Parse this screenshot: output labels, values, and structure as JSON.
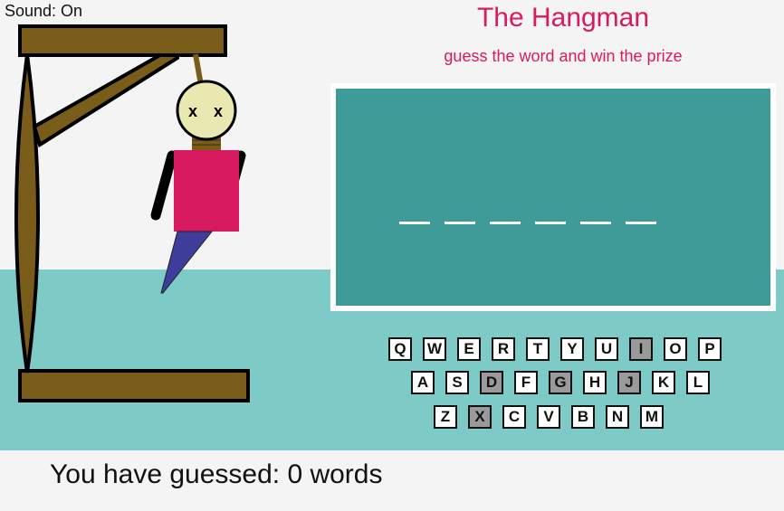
{
  "sound": {
    "label": "Sound: On"
  },
  "header": {
    "title": "The Hangman",
    "subtitle": "guess the word and win the prize"
  },
  "word": {
    "slot_count": 6
  },
  "keyboard": {
    "rows": [
      [
        "Q",
        "W",
        "E",
        "R",
        "T",
        "Y",
        "U",
        "I",
        "O",
        "P"
      ],
      [
        "A",
        "S",
        "D",
        "F",
        "G",
        "H",
        "J",
        "K",
        "L"
      ],
      [
        "Z",
        "X",
        "C",
        "V",
        "B",
        "N",
        "M"
      ]
    ],
    "used_letters": [
      "I",
      "D",
      "G",
      "J",
      "X"
    ]
  },
  "score": {
    "label": "You have guessed: 0 words"
  },
  "colors": {
    "accent": "#d81b60",
    "board": "#3f9b97",
    "band": "#7ecac7",
    "wood": "#7a5c1a",
    "shirt": "#d81b60",
    "pants": "#3f3d9b",
    "head": "#e8e8b0",
    "key_used": "#9a9a9a"
  }
}
